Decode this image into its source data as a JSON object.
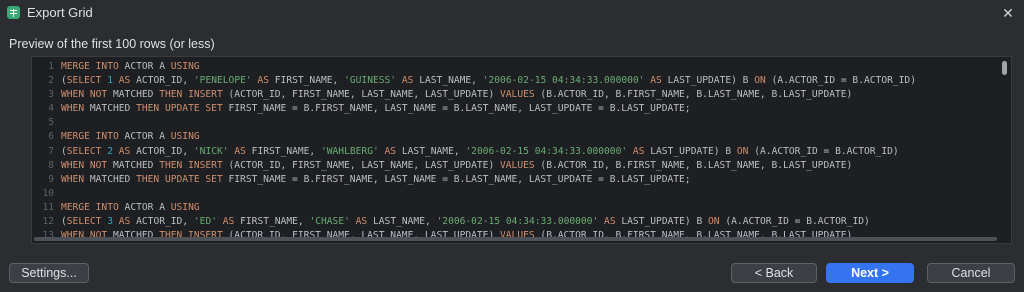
{
  "window": {
    "title": "Export Grid",
    "close_glyph": "✕",
    "app_icon": "grid-table-icon"
  },
  "preview_label": "Preview of the first 100 rows (or less)",
  "code": {
    "lines": [
      {
        "n": "1",
        "tokens": [
          {
            "t": "MERGE INTO",
            "c": "kw"
          },
          {
            "t": " ACTOR A ",
            "c": ""
          },
          {
            "t": "USING",
            "c": "kw"
          }
        ]
      },
      {
        "n": "2",
        "tokens": [
          {
            "t": "(",
            "c": ""
          },
          {
            "t": "SELECT",
            "c": "kw"
          },
          {
            "t": " ",
            "c": ""
          },
          {
            "t": "1",
            "c": "num"
          },
          {
            "t": " ",
            "c": ""
          },
          {
            "t": "AS",
            "c": "kw"
          },
          {
            "t": " ACTOR_ID, ",
            "c": ""
          },
          {
            "t": "'PENELOPE'",
            "c": "str"
          },
          {
            "t": " ",
            "c": ""
          },
          {
            "t": "AS",
            "c": "kw"
          },
          {
            "t": " FIRST_NAME, ",
            "c": ""
          },
          {
            "t": "'GUINESS'",
            "c": "str"
          },
          {
            "t": " ",
            "c": ""
          },
          {
            "t": "AS",
            "c": "kw"
          },
          {
            "t": " LAST_NAME, ",
            "c": ""
          },
          {
            "t": "'2006-02-15 04:34:33.000000'",
            "c": "str"
          },
          {
            "t": " ",
            "c": ""
          },
          {
            "t": "AS",
            "c": "kw"
          },
          {
            "t": " LAST_UPDATE) B ",
            "c": ""
          },
          {
            "t": "ON",
            "c": "kw"
          },
          {
            "t": " (A.ACTOR_ID = B.ACTOR_ID)",
            "c": ""
          }
        ]
      },
      {
        "n": "3",
        "tokens": [
          {
            "t": "WHEN NOT",
            "c": "kw"
          },
          {
            "t": " MATCHED ",
            "c": ""
          },
          {
            "t": "THEN INSERT",
            "c": "kw"
          },
          {
            "t": " (ACTOR_ID, FIRST_NAME, LAST_NAME, LAST_UPDATE) ",
            "c": ""
          },
          {
            "t": "VALUES",
            "c": "kw"
          },
          {
            "t": " (B.ACTOR_ID, B.FIRST_NAME, B.LAST_NAME, B.LAST_UPDATE)",
            "c": ""
          }
        ]
      },
      {
        "n": "4",
        "tokens": [
          {
            "t": "WHEN",
            "c": "kw"
          },
          {
            "t": " MATCHED ",
            "c": ""
          },
          {
            "t": "THEN UPDATE SET",
            "c": "kw"
          },
          {
            "t": " FIRST_NAME = B.FIRST_NAME, LAST_NAME = B.LAST_NAME, LAST_UPDATE = B.LAST_UPDATE;",
            "c": ""
          }
        ]
      },
      {
        "n": "5",
        "tokens": []
      },
      {
        "n": "6",
        "tokens": [
          {
            "t": "MERGE INTO",
            "c": "kw"
          },
          {
            "t": " ACTOR A ",
            "c": ""
          },
          {
            "t": "USING",
            "c": "kw"
          }
        ]
      },
      {
        "n": "7",
        "tokens": [
          {
            "t": "(",
            "c": ""
          },
          {
            "t": "SELECT",
            "c": "kw"
          },
          {
            "t": " ",
            "c": ""
          },
          {
            "t": "2",
            "c": "num"
          },
          {
            "t": " ",
            "c": ""
          },
          {
            "t": "AS",
            "c": "kw"
          },
          {
            "t": " ACTOR_ID, ",
            "c": ""
          },
          {
            "t": "'NICK'",
            "c": "str"
          },
          {
            "t": " ",
            "c": ""
          },
          {
            "t": "AS",
            "c": "kw"
          },
          {
            "t": " FIRST_NAME, ",
            "c": ""
          },
          {
            "t": "'WAHLBERG'",
            "c": "str"
          },
          {
            "t": " ",
            "c": ""
          },
          {
            "t": "AS",
            "c": "kw"
          },
          {
            "t": " LAST_NAME, ",
            "c": ""
          },
          {
            "t": "'2006-02-15 04:34:33.000000'",
            "c": "str"
          },
          {
            "t": " ",
            "c": ""
          },
          {
            "t": "AS",
            "c": "kw"
          },
          {
            "t": " LAST_UPDATE) B ",
            "c": ""
          },
          {
            "t": "ON",
            "c": "kw"
          },
          {
            "t": " (A.ACTOR_ID = B.ACTOR_ID)",
            "c": ""
          }
        ]
      },
      {
        "n": "8",
        "tokens": [
          {
            "t": "WHEN NOT",
            "c": "kw"
          },
          {
            "t": " MATCHED ",
            "c": ""
          },
          {
            "t": "THEN INSERT",
            "c": "kw"
          },
          {
            "t": " (ACTOR_ID, FIRST_NAME, LAST_NAME, LAST_UPDATE) ",
            "c": ""
          },
          {
            "t": "VALUES",
            "c": "kw"
          },
          {
            "t": " (B.ACTOR_ID, B.FIRST_NAME, B.LAST_NAME, B.LAST_UPDATE)",
            "c": ""
          }
        ]
      },
      {
        "n": "9",
        "tokens": [
          {
            "t": "WHEN",
            "c": "kw"
          },
          {
            "t": " MATCHED ",
            "c": ""
          },
          {
            "t": "THEN UPDATE SET",
            "c": "kw"
          },
          {
            "t": " FIRST_NAME = B.FIRST_NAME, LAST_NAME = B.LAST_NAME, LAST_UPDATE = B.LAST_UPDATE;",
            "c": ""
          }
        ]
      },
      {
        "n": "10",
        "tokens": []
      },
      {
        "n": "11",
        "tokens": [
          {
            "t": "MERGE INTO",
            "c": "kw"
          },
          {
            "t": " ACTOR A ",
            "c": ""
          },
          {
            "t": "USING",
            "c": "kw"
          }
        ]
      },
      {
        "n": "12",
        "tokens": [
          {
            "t": "(",
            "c": ""
          },
          {
            "t": "SELECT",
            "c": "kw"
          },
          {
            "t": " ",
            "c": ""
          },
          {
            "t": "3",
            "c": "num"
          },
          {
            "t": " ",
            "c": ""
          },
          {
            "t": "AS",
            "c": "kw"
          },
          {
            "t": " ACTOR_ID, ",
            "c": ""
          },
          {
            "t": "'ED'",
            "c": "str"
          },
          {
            "t": " ",
            "c": ""
          },
          {
            "t": "AS",
            "c": "kw"
          },
          {
            "t": " FIRST_NAME, ",
            "c": ""
          },
          {
            "t": "'CHASE'",
            "c": "str"
          },
          {
            "t": " ",
            "c": ""
          },
          {
            "t": "AS",
            "c": "kw"
          },
          {
            "t": " LAST_NAME, ",
            "c": ""
          },
          {
            "t": "'2006-02-15 04:34:33.000000'",
            "c": "str"
          },
          {
            "t": " ",
            "c": ""
          },
          {
            "t": "AS",
            "c": "kw"
          },
          {
            "t": " LAST_UPDATE) B ",
            "c": ""
          },
          {
            "t": "ON",
            "c": "kw"
          },
          {
            "t": " (A.ACTOR_ID = B.ACTOR_ID)",
            "c": ""
          }
        ]
      },
      {
        "n": "13",
        "tokens": [
          {
            "t": "WHEN NOT",
            "c": "kw"
          },
          {
            "t": " MATCHED ",
            "c": ""
          },
          {
            "t": "THEN INSERT",
            "c": "kw"
          },
          {
            "t": " (ACTOR_ID, FIRST_NAME, LAST_NAME, LAST_UPDATE) ",
            "c": ""
          },
          {
            "t": "VALUES",
            "c": "kw"
          },
          {
            "t": " (B.ACTOR_ID, B.FIRST_NAME, B.LAST_NAME, B.LAST_UPDATE)",
            "c": ""
          }
        ]
      }
    ],
    "colors": {
      "keyword": "#cf8e6d",
      "string": "#6aab73",
      "number": "#2aacb8",
      "text": "#bcbec4"
    }
  },
  "buttons": {
    "settings": "Settings...",
    "back": "< Back",
    "next": "Next >",
    "cancel": "Cancel"
  },
  "accent_color": "#3574f0"
}
